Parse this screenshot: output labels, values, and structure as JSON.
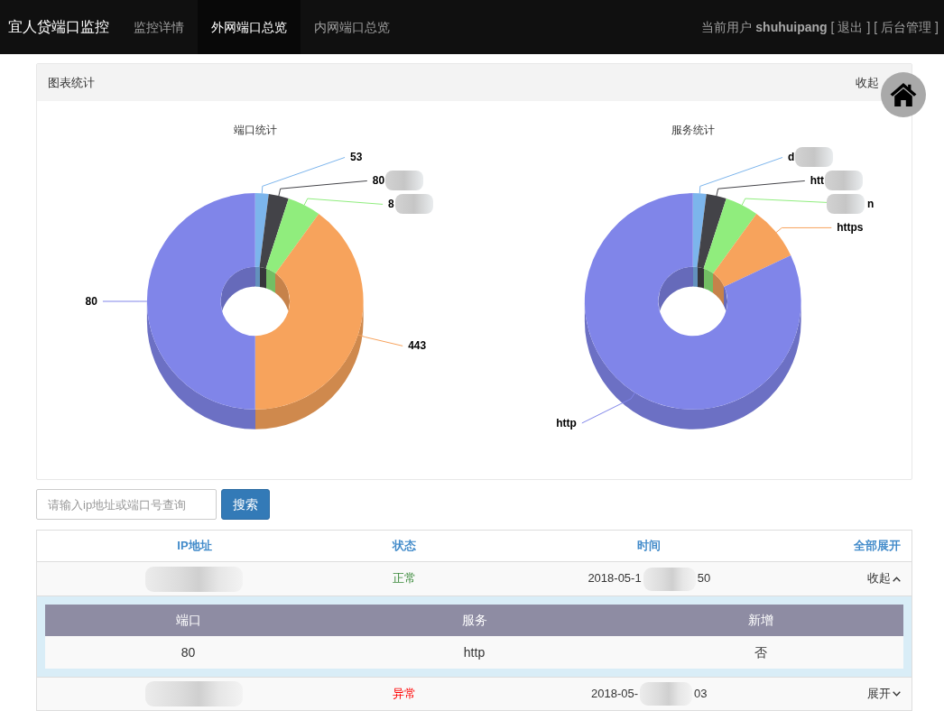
{
  "navbar": {
    "brand": "宜人贷端口监控",
    "items": [
      {
        "label": "监控详情",
        "selected": false
      },
      {
        "label": "外网端口总览",
        "selected": true
      },
      {
        "label": "内网端口总览",
        "selected": false
      }
    ],
    "user_bar": [
      {
        "kind": "text",
        "text": "当前用户 **shuhuipang** ["
      },
      {
        "kind": "link",
        "text": "退出"
      },
      {
        "kind": "text",
        "text": "] ["
      },
      {
        "kind": "link",
        "text": "后台管理"
      },
      {
        "kind": "text",
        "text": "]"
      }
    ]
  },
  "chart_panel": {
    "title": "图表统计",
    "toggle": "收起",
    "charts": [
      {
        "label_blur_after": [
          false,
          true,
          true,
          false,
          false
        ],
        "chart_data": {
          "type": "donut",
          "title": "端口统计",
          "categories": [
            "53",
            "80",
            "8",
            "443",
            "80"
          ],
          "values": [
            2,
            3,
            5,
            40,
            50
          ]
        }
      },
      {
        "label_blur_after": [
          true,
          true,
          false,
          false,
          false
        ],
        "label_blur_before": [
          false,
          false,
          true,
          false,
          false
        ],
        "chart_data": {
          "type": "donut",
          "title": "服务统计",
          "categories": [
            "d",
            "htt",
            "n",
            "https",
            "http"
          ],
          "values": [
            2,
            3,
            5,
            8,
            82
          ]
        }
      }
    ]
  },
  "search": {
    "placeholder": "请输入ip地址或端口号查询",
    "button": "搜索"
  },
  "table": {
    "columns": [
      "IP地址",
      "状态",
      "时间"
    ],
    "expand_all": "全部展开",
    "rows": [
      {
        "ip_blurred": true,
        "status": "正常",
        "abnormal": false,
        "time": [
          "2018-05-1",
          "50"
        ],
        "toggle": "收起",
        "expanded": true,
        "details": {
          "columns": [
            "端口",
            "服务",
            "新增"
          ],
          "rows": [
            [
              "80",
              "http",
              "否"
            ]
          ]
        }
      },
      {
        "ip_blurred": true,
        "status": "异常",
        "abnormal": true,
        "time": [
          "2018-05-",
          "03"
        ],
        "toggle": "展开",
        "expanded": false
      }
    ]
  }
}
